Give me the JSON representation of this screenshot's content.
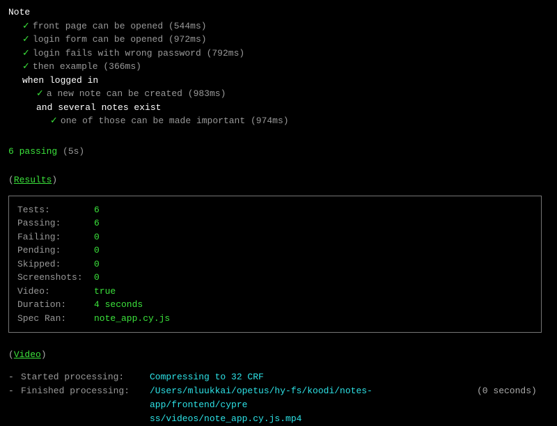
{
  "suite": {
    "title": "Note",
    "tests": [
      {
        "name": "front page can be opened",
        "duration": "(544ms)"
      },
      {
        "name": "login form can be opened",
        "duration": "(972ms)"
      },
      {
        "name": "login fails with wrong password",
        "duration": "(792ms)"
      },
      {
        "name": "then example",
        "duration": "(366ms)"
      }
    ],
    "context1": {
      "title": "when logged in",
      "tests": [
        {
          "name": "a new note can be created",
          "duration": "(983ms)"
        }
      ],
      "context2": {
        "title": "and several notes exist",
        "tests": [
          {
            "name": "one of those can be made important",
            "duration": "(974ms)"
          }
        ]
      }
    }
  },
  "passing": {
    "count": "6 passing",
    "time": "(5s)"
  },
  "sections": {
    "results": "Results",
    "video": "Video"
  },
  "results": {
    "tests_label": "Tests:",
    "tests_val": "6",
    "passing_label": "Passing:",
    "passing_val": "6",
    "failing_label": "Failing:",
    "failing_val": "0",
    "pending_label": "Pending:",
    "pending_val": "0",
    "skipped_label": "Skipped:",
    "skipped_val": "0",
    "screenshots_label": "Screenshots:",
    "screenshots_val": "0",
    "video_label": "Video:",
    "video_val": "true",
    "duration_label": "Duration:",
    "duration_val": "4 seconds",
    "spec_label": "Spec Ran:",
    "spec_val": "note_app.cy.js"
  },
  "video": {
    "started_label": "Started processing:",
    "started_val": "Compressing to 32 CRF",
    "finished_label": "Finished processing:",
    "finished_val1": "/Users/mluukkai/opetus/hy-fs/koodi/notes-app/frontend/cypre",
    "finished_val2": "ss/videos/note_app.cy.js.mp4",
    "finished_time": "(0 seconds)"
  },
  "glyphs": {
    "check": "✓",
    "dash": "-"
  }
}
